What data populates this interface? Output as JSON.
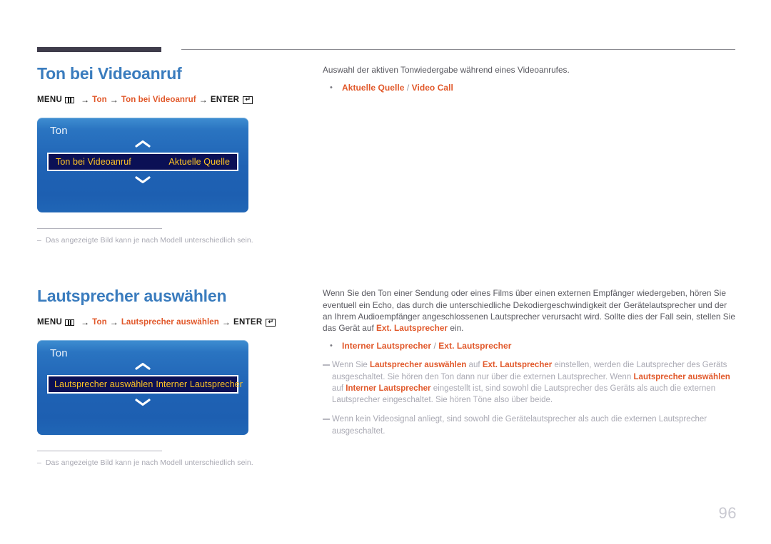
{
  "page": {
    "number": "96",
    "accent_color": "#e1582a",
    "heading_color": "#3a7cbe",
    "osd_select_color": "#ffc425"
  },
  "sections": [
    {
      "title": "Ton bei Videoanruf",
      "path": {
        "menu_label": "MENU",
        "menu_icon": "menu-icon",
        "arrow": "→",
        "step1": "Ton",
        "step2": "Ton bei Videoanruf",
        "enter_label": "ENTER",
        "enter_icon": "enter-return-icon"
      },
      "osd": {
        "title": "Ton",
        "up_icon": "chevron-up-icon",
        "down_icon": "chevron-down-icon",
        "row_label": "Ton bei Videoanruf",
        "row_value": "Aktuelle Quelle"
      },
      "footnote": {
        "dash": "–",
        "text": "Das angezeigte Bild kann je nach Modell unterschiedlich sein."
      },
      "right": {
        "intro": "Auswahl der aktiven Tonwiedergabe während eines Videoanrufes.",
        "bullet_dot": "•",
        "bullet_option_1": "Aktuelle Quelle",
        "bullet_separator": " / ",
        "bullet_option_2": "Video Call"
      }
    },
    {
      "title": "Lautsprecher auswählen",
      "path": {
        "menu_label": "MENU",
        "menu_icon": "menu-icon",
        "arrow": "→",
        "step1": "Ton",
        "step2": "Lautsprecher auswählen",
        "enter_label": "ENTER",
        "enter_icon": "enter-return-icon"
      },
      "osd": {
        "title": "Ton",
        "up_icon": "chevron-up-icon",
        "down_icon": "chevron-down-icon",
        "row_label": "Lautsprecher auswählen",
        "row_value": "Interner Lautsprecher"
      },
      "footnote": {
        "dash": "–",
        "text": "Das angezeigte Bild kann je nach Modell unterschiedlich sein."
      },
      "right": {
        "para_1a": "Wenn Sie den Ton einer Sendung oder eines Films über einen externen Empfänger wiedergeben, hören Sie eventuell ein Echo, das durch die unterschiedliche Dekodiergeschwindigkeit der Gerätelautsprecher und der an Ihrem Audioempfänger angeschlossenen Lautsprecher verursacht wird. Sollte dies der Fall sein, stellen Sie das Gerät auf ",
        "para_1b": "Ext. Lautsprecher",
        "para_1c": " ein.",
        "bullet_dot": "•",
        "bullet_option_1": "Interner Lautsprecher",
        "bullet_separator": " / ",
        "bullet_option_2": "Ext. Lautsprecher",
        "note_1": {
          "t1": "Wenn Sie ",
          "b1": "Lautsprecher auswählen",
          "t2": " auf ",
          "b2": "Ext. Lautsprecher",
          "t3": " einstellen, werden die Lautsprecher des Geräts ausgeschaltet. Sie hören den Ton dann nur über die externen Lautsprecher. Wenn ",
          "b3": "Lautsprecher auswählen",
          "t4": " auf ",
          "b4": "Interner Lautsprecher",
          "t5": " eingestellt ist, sind sowohl die Lautsprecher des Geräts als auch die externen Lautsprecher eingeschaltet. Sie hören Töne also über beide."
        },
        "note_2": "Wenn kein Videosignal anliegt, sind sowohl die Gerätelautsprecher als auch die externen Lautsprecher ausgeschaltet."
      }
    }
  ]
}
